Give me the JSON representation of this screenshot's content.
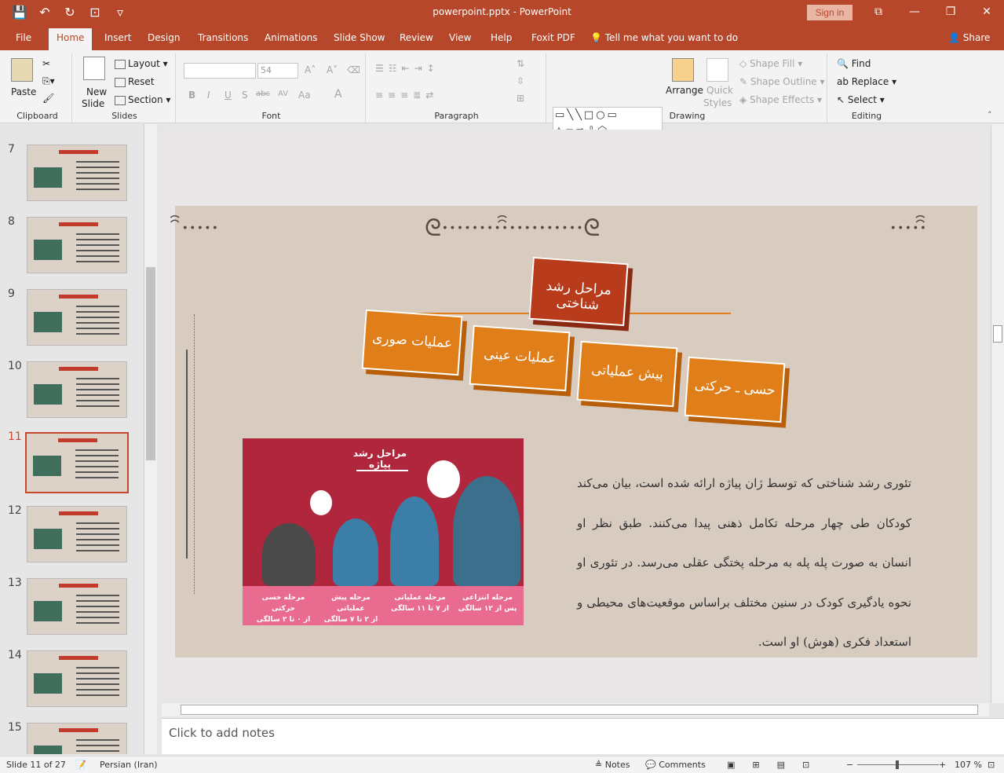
{
  "window": {
    "title": "powerpoint.pptx - PowerPoint",
    "signin": "Sign in"
  },
  "qat": {
    "save": "💾",
    "undo": "↶",
    "redo": "↻",
    "present": "⊡",
    "more": "▿"
  },
  "winctl": {
    "restore": "⧉",
    "min": "—",
    "max": "❐",
    "close": "✕"
  },
  "tabs": [
    "File",
    "Home",
    "Insert",
    "Design",
    "Transitions",
    "Animations",
    "Slide Show",
    "Review",
    "View",
    "Help",
    "Foxit PDF"
  ],
  "tellme": "Tell me what you want to do",
  "share": "Share",
  "ribbon": {
    "clipboard": {
      "label": "Clipboard",
      "paste": "Paste"
    },
    "slides": {
      "label": "Slides",
      "new_slide_1": "New",
      "new_slide_2": "Slide",
      "layout": "Layout",
      "reset": "Reset",
      "section": "Section"
    },
    "font": {
      "label": "Font",
      "size": "54",
      "bold": "B",
      "italic": "I",
      "underline": "U",
      "shadow": "S",
      "strike": "abc",
      "spacing": "AV",
      "case": "Aa",
      "color": "A"
    },
    "paragraph": {
      "label": "Paragraph"
    },
    "drawing": {
      "label": "Drawing",
      "arrange": "Arrange",
      "quick_styles_1": "Quick",
      "quick_styles_2": "Styles",
      "shape_fill": "Shape Fill",
      "shape_outline": "Shape Outline",
      "shape_effects": "Shape Effects"
    },
    "editing": {
      "label": "Editing",
      "find": "Find",
      "replace": "Replace",
      "select": "Select"
    }
  },
  "thumbnails": [
    {
      "num": "7",
      "selected": false
    },
    {
      "num": "8",
      "selected": false
    },
    {
      "num": "9",
      "selected": false
    },
    {
      "num": "10",
      "selected": false
    },
    {
      "num": "11",
      "selected": true
    },
    {
      "num": "12",
      "selected": false
    },
    {
      "num": "13",
      "selected": false
    },
    {
      "num": "14",
      "selected": false
    },
    {
      "num": "15",
      "selected": false
    }
  ],
  "slide": {
    "top_box": "مراحل رشد شناختی",
    "boxes": [
      "عملیات صوری",
      "عملیات عینی",
      "پیش عملیاتی",
      "حسی ـ حرکتی"
    ],
    "paragraph": "تئوری رشد شناختی که توسط ژان پیاژه ارائه شده است، بیان می‌کند کودکان طی چهار مرحله تکامل ذهنی پیدا می‌کنند. طبق نظر او انسان به صورت پله پله به مرحله پختگی عقلی می‌رسد. در تئوری او نحوه یادگیری کودک در سنین مختلف براساس موقعیت‌های محیطی و استعداد فکری (هوش) او است.",
    "image": {
      "title": "مراحل رشد پیاژه",
      "stages": [
        {
          "l1": "مرحله حسی حرکتی",
          "l2": "از ۰ تا ۲ سالگی"
        },
        {
          "l1": "مرحله پیش عملیاتی",
          "l2": "از ۲ تا ۷ سالگی"
        },
        {
          "l1": "مرحله عملیاتی",
          "l2": "از ۷ تا ۱۱ سالگی"
        },
        {
          "l1": "مرحله انتزاعی",
          "l2": "پس از ۱۲ سالگی"
        }
      ]
    }
  },
  "notes_placeholder": "Click to add notes",
  "status": {
    "slide": "Slide 11 of 27",
    "language": "Persian (Iran)",
    "notes": "Notes",
    "comments": "Comments",
    "zoom": "107 %"
  },
  "colors": {
    "accent": "#b7472a",
    "box": "#e07f1a",
    "top_box": "#b83c1c",
    "image_bg": "#b0273d"
  }
}
